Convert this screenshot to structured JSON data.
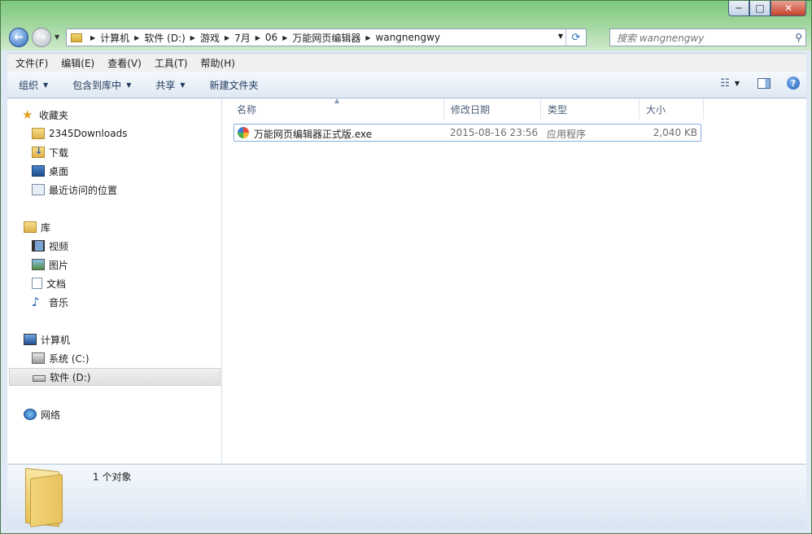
{
  "window": {
    "caption_buttons": {
      "minimize": "─",
      "maximize": "□",
      "close": "✕"
    }
  },
  "nav": {
    "back_icon": "←",
    "forward_icon": "→",
    "breadcrumbs": [
      "计算机",
      "软件 (D:)",
      "游戏",
      "7月",
      "06",
      "万能网页编辑器",
      "wangnengwy"
    ],
    "search_placeholder": "搜索 wangnengwy"
  },
  "menu": [
    "文件(F)",
    "编辑(E)",
    "查看(V)",
    "工具(T)",
    "帮助(H)"
  ],
  "toolbar": {
    "organize": "组织",
    "include_library": "包含到库中",
    "share": "共享",
    "new_folder": "新建文件夹"
  },
  "sidebar": {
    "favorites": {
      "label": "收藏夹",
      "items": [
        "2345Downloads",
        "下载",
        "桌面",
        "最近访问的位置"
      ]
    },
    "libraries": {
      "label": "库",
      "items": [
        "视频",
        "图片",
        "文档",
        "音乐"
      ]
    },
    "computer": {
      "label": "计算机",
      "items": [
        "系统 (C:)",
        "软件 (D:)"
      ]
    },
    "network": {
      "label": "网络"
    }
  },
  "columns": {
    "name": "名称",
    "modified": "修改日期",
    "type": "类型",
    "size": "大小"
  },
  "files": [
    {
      "name": "万能网页编辑器正式版.exe",
      "modified": "2015-08-16 23:56",
      "type": "应用程序",
      "size": "2,040 KB"
    }
  ],
  "details": {
    "count": "1 个对象"
  }
}
